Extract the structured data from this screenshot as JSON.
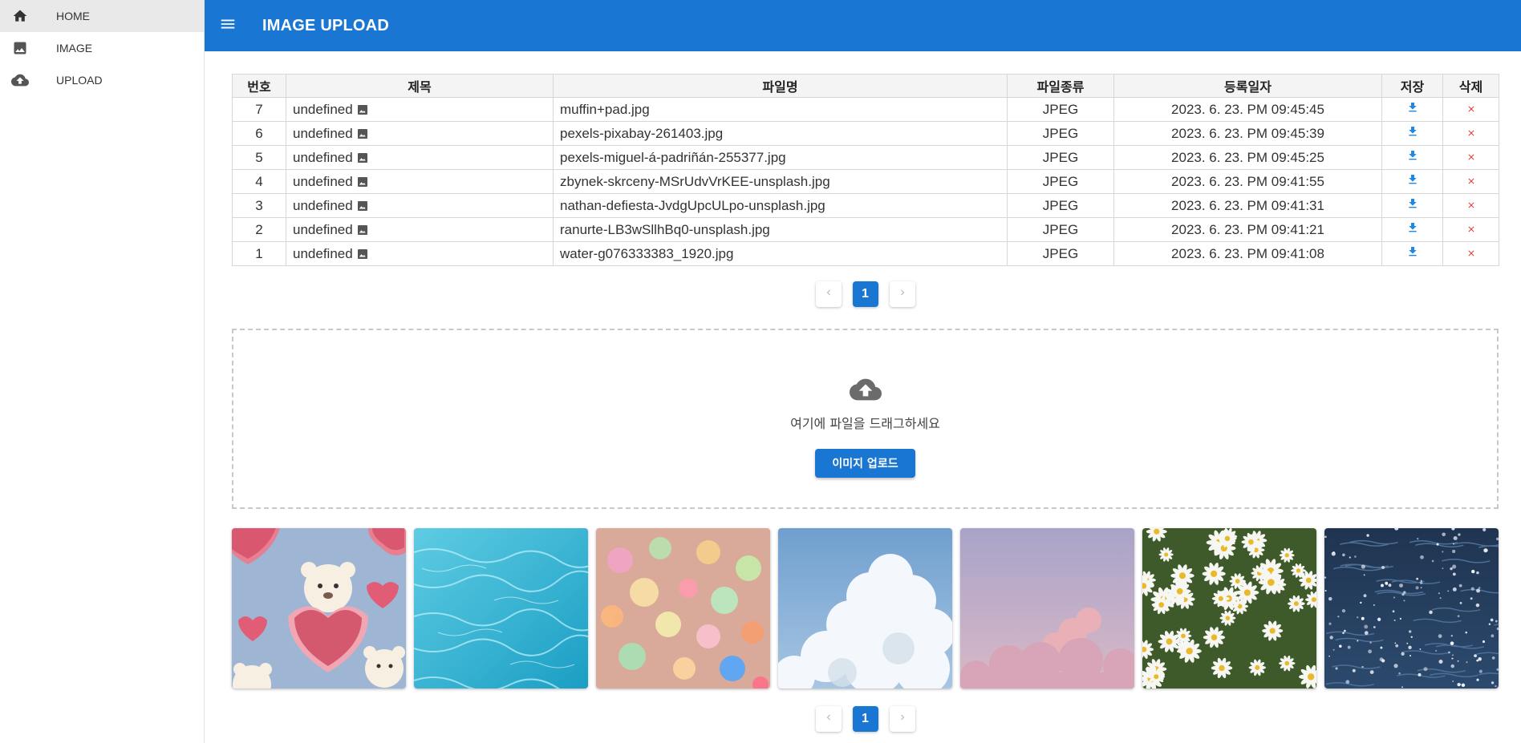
{
  "sidebar": {
    "items": [
      {
        "label": "HOME",
        "icon": "home-icon"
      },
      {
        "label": "IMAGE",
        "icon": "image-icon"
      },
      {
        "label": "UPLOAD",
        "icon": "cloud-upload-icon"
      }
    ]
  },
  "header": {
    "title": "IMAGE UPLOAD",
    "menu_icon": "menu-icon"
  },
  "table": {
    "columns": [
      "번호",
      "제목",
      "파일명",
      "파일종류",
      "등록일자",
      "저장",
      "삭제"
    ],
    "rows": [
      {
        "no": "7",
        "title": "undefined",
        "filename": "muffin+pad.jpg",
        "type": "JPEG",
        "date": "2023. 6. 23. PM 09:45:45"
      },
      {
        "no": "6",
        "title": "undefined",
        "filename": "pexels-pixabay-261403.jpg",
        "type": "JPEG",
        "date": "2023. 6. 23. PM 09:45:39"
      },
      {
        "no": "5",
        "title": "undefined",
        "filename": "pexels-miguel-á-padriñán-255377.jpg",
        "type": "JPEG",
        "date": "2023. 6. 23. PM 09:45:25"
      },
      {
        "no": "4",
        "title": "undefined",
        "filename": "zbynek-skrceny-MSrUdvVrKEE-unsplash.jpg",
        "type": "JPEG",
        "date": "2023. 6. 23. PM 09:41:55"
      },
      {
        "no": "3",
        "title": "undefined",
        "filename": "nathan-defiesta-JvdgUpcULpo-unsplash.jpg",
        "type": "JPEG",
        "date": "2023. 6. 23. PM 09:41:31"
      },
      {
        "no": "2",
        "title": "undefined",
        "filename": "ranurte-LB3wSllhBq0-unsplash.jpg",
        "type": "JPEG",
        "date": "2023. 6. 23. PM 09:41:21"
      },
      {
        "no": "1",
        "title": "undefined",
        "filename": "water-g076333383_1920.jpg",
        "type": "JPEG",
        "date": "2023. 6. 23. PM 09:41:08"
      }
    ]
  },
  "pagination": {
    "current": "1",
    "prev_icon": "chevron-left-icon",
    "next_icon": "chevron-right-icon"
  },
  "upload": {
    "hint": "여기에 파일을 드래그하세요",
    "button_label": "이미지 업로드",
    "icon": "cloud-upload-icon"
  },
  "gallery": {
    "images": [
      {
        "subject": "teddy-bears-hearts"
      },
      {
        "subject": "pool-water"
      },
      {
        "subject": "bokeh-lights"
      },
      {
        "subject": "clouds-blue-sky"
      },
      {
        "subject": "pink-cloud-sunset"
      },
      {
        "subject": "daisies"
      },
      {
        "subject": "sea-sparkles"
      }
    ]
  },
  "colors": {
    "primary": "#1976d2",
    "delete": "#e53935",
    "download": "#1e88e5"
  }
}
